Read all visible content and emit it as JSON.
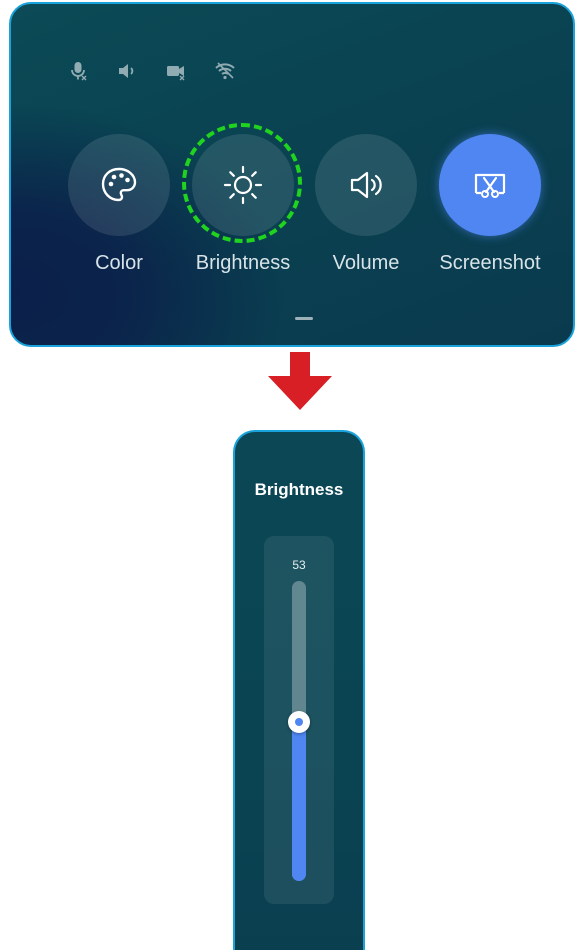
{
  "quick_settings": {
    "status_icons": [
      {
        "name": "microphone-muted-icon"
      },
      {
        "name": "speaker-icon"
      },
      {
        "name": "camera-muted-icon"
      },
      {
        "name": "wifi-off-icon"
      }
    ],
    "tiles": {
      "color": {
        "label": "Color",
        "icon": "palette-icon"
      },
      "brightness": {
        "label": "Brightness",
        "icon": "sun-icon",
        "highlighted": true
      },
      "volume": {
        "label": "Volume",
        "icon": "speaker-volume-icon"
      },
      "screenshot": {
        "label": "Screenshot",
        "icon": "screenshot-scissors-icon",
        "active": true
      }
    }
  },
  "arrow": {
    "icon": "arrow-down-icon",
    "color": "#d81f26"
  },
  "brightness_panel": {
    "title": "Brightness",
    "value": "53",
    "level": 0.53
  },
  "colors": {
    "accent": "#4f86f2",
    "border": "#1aa3db",
    "highlight": "#1fd31f",
    "panel_bg": "#0a4251"
  }
}
